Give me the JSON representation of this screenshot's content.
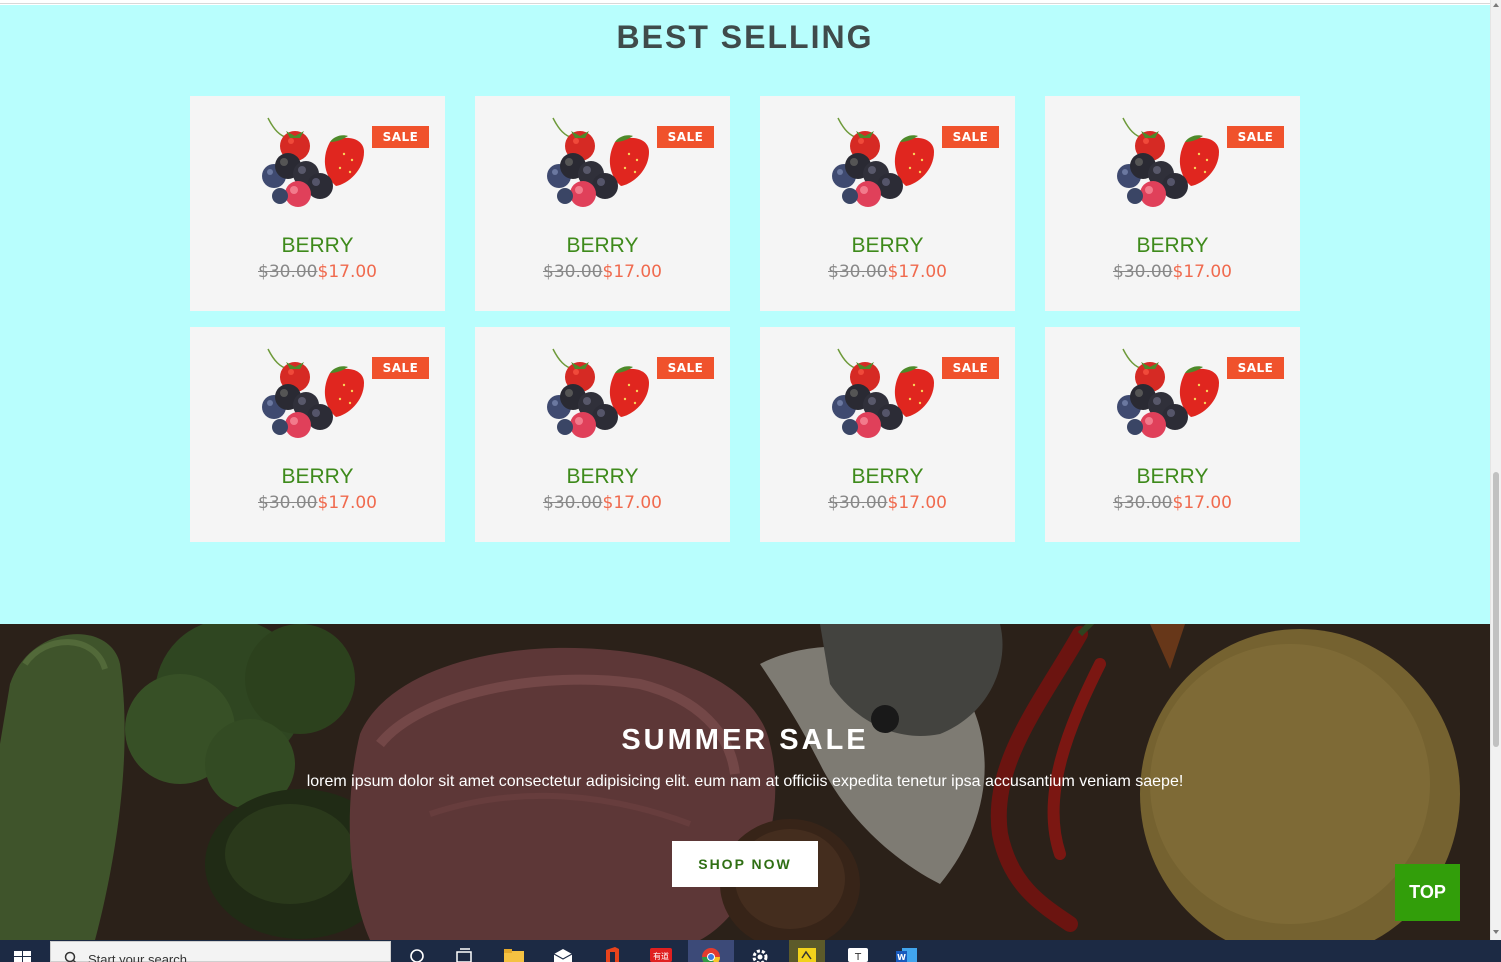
{
  "best_selling": {
    "title": "BEST SELLING",
    "products": [
      {
        "badge": "SALE",
        "name": "BERRY",
        "old_price": "$30.00",
        "price": "$17.00"
      },
      {
        "badge": "SALE",
        "name": "BERRY",
        "old_price": "$30.00",
        "price": "$17.00"
      },
      {
        "badge": "SALE",
        "name": "BERRY",
        "old_price": "$30.00",
        "price": "$17.00"
      },
      {
        "badge": "SALE",
        "name": "BERRY",
        "old_price": "$30.00",
        "price": "$17.00"
      },
      {
        "badge": "SALE",
        "name": "BERRY",
        "old_price": "$30.00",
        "price": "$17.00"
      },
      {
        "badge": "SALE",
        "name": "BERRY",
        "old_price": "$30.00",
        "price": "$17.00"
      },
      {
        "badge": "SALE",
        "name": "BERRY",
        "old_price": "$30.00",
        "price": "$17.00"
      },
      {
        "badge": "SALE",
        "name": "BERRY",
        "old_price": "$30.00",
        "price": "$17.00"
      }
    ]
  },
  "banner": {
    "title": "SUMMER SALE",
    "text": "lorem ipsum dolor sit amet consectetur adipisicing elit. eum nam at officiis expedita tenetur ipsa accusantium veniam saepe!",
    "button": "SHOP NOW"
  },
  "top_button": "TOP",
  "taskbar": {
    "search_placeholder": "Start your search",
    "icons": [
      "windows-logo-icon",
      "search-icon",
      "task-view-icon",
      "file-explorer-icon",
      "mail-icon",
      "office-icon",
      "youdao-dict-icon",
      "chrome-icon",
      "settings-icon",
      "sticky-app-icon",
      "typora-icon",
      "word-icon"
    ]
  },
  "colors": {
    "section_bg": "#b8fefd",
    "card_bg": "#f5f5f5",
    "badge": "#f0522c",
    "product_name": "#3e8a1b",
    "new_price": "#f06a4e",
    "old_price": "#888888",
    "top_button": "#329e0a",
    "shop_button_text": "#2f6f14",
    "taskbar": "#1c2a44"
  }
}
